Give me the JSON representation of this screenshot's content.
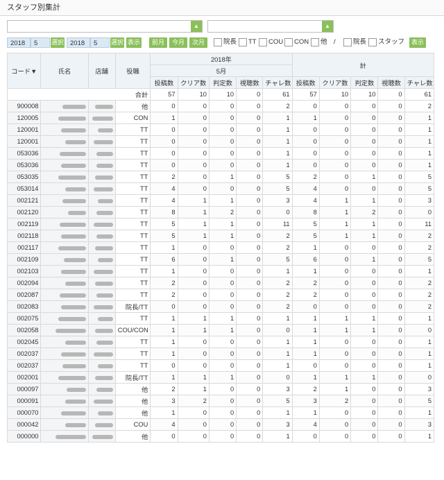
{
  "title": "スタッフ別集計",
  "controls": {
    "year1": "2018",
    "month1": "5",
    "select1": "選択",
    "year2": "2018",
    "month2": "5",
    "select2": "選択",
    "show": "表示",
    "prev": "前月",
    "current": "今月",
    "next": "次月",
    "filters": [
      "院長",
      "TT",
      "COU",
      "CON",
      "他"
    ],
    "separator": "/",
    "filters2": [
      "院長",
      "スタッフ"
    ],
    "show2": "表示"
  },
  "table": {
    "h_code": "コード▼",
    "h_name": "氏名",
    "h_store": "店舗",
    "h_role": "役職",
    "h_year": "2018年",
    "h_month": "5月",
    "h_total": "計",
    "cols": [
      "投稿数",
      "クリア数",
      "判定数",
      "視聴数",
      "チャレ数"
    ],
    "total_label": "合計",
    "total_values": [
      "57",
      "10",
      "10",
      "0",
      "61",
      "57",
      "10",
      "10",
      "0",
      "61"
    ],
    "rows": [
      {
        "code": "900008",
        "role": "他",
        "v": [
          "0",
          "0",
          "0",
          "0",
          "2",
          "0",
          "0",
          "0",
          "0",
          "2"
        ]
      },
      {
        "code": "120005",
        "role": "CON",
        "v": [
          "1",
          "0",
          "0",
          "0",
          "1",
          "1",
          "0",
          "0",
          "0",
          "1"
        ]
      },
      {
        "code": "120001",
        "role": "TT",
        "v": [
          "0",
          "0",
          "0",
          "0",
          "1",
          "0",
          "0",
          "0",
          "0",
          "1"
        ]
      },
      {
        "code": "120001",
        "role": "TT",
        "v": [
          "0",
          "0",
          "0",
          "0",
          "1",
          "0",
          "0",
          "0",
          "0",
          "1"
        ]
      },
      {
        "code": "053036",
        "role": "TT",
        "v": [
          "0",
          "0",
          "0",
          "0",
          "1",
          "0",
          "0",
          "0",
          "0",
          "1"
        ]
      },
      {
        "code": "053036",
        "role": "TT",
        "v": [
          "0",
          "0",
          "0",
          "0",
          "1",
          "0",
          "0",
          "0",
          "0",
          "1"
        ]
      },
      {
        "code": "053035",
        "role": "TT",
        "v": [
          "2",
          "0",
          "1",
          "0",
          "5",
          "2",
          "0",
          "1",
          "0",
          "5"
        ]
      },
      {
        "code": "053014",
        "role": "TT",
        "v": [
          "4",
          "0",
          "0",
          "0",
          "5",
          "4",
          "0",
          "0",
          "0",
          "5"
        ]
      },
      {
        "code": "002121",
        "role": "TT",
        "v": [
          "4",
          "1",
          "1",
          "0",
          "3",
          "4",
          "1",
          "1",
          "0",
          "3"
        ]
      },
      {
        "code": "002120",
        "role": "TT",
        "v": [
          "8",
          "1",
          "2",
          "0",
          "0",
          "8",
          "1",
          "2",
          "0",
          "0"
        ]
      },
      {
        "code": "002119",
        "role": "TT",
        "v": [
          "5",
          "1",
          "1",
          "0",
          "11",
          "5",
          "1",
          "1",
          "0",
          "11"
        ]
      },
      {
        "code": "002118",
        "role": "TT",
        "v": [
          "5",
          "1",
          "1",
          "0",
          "2",
          "5",
          "1",
          "1",
          "0",
          "2"
        ]
      },
      {
        "code": "002117",
        "role": "TT",
        "v": [
          "1",
          "0",
          "0",
          "0",
          "2",
          "1",
          "0",
          "0",
          "0",
          "2"
        ]
      },
      {
        "code": "002109",
        "role": "TT",
        "v": [
          "6",
          "0",
          "1",
          "0",
          "5",
          "6",
          "0",
          "1",
          "0",
          "5"
        ]
      },
      {
        "code": "002103",
        "role": "TT",
        "v": [
          "1",
          "0",
          "0",
          "0",
          "1",
          "1",
          "0",
          "0",
          "0",
          "1"
        ]
      },
      {
        "code": "002094",
        "role": "TT",
        "v": [
          "2",
          "0",
          "0",
          "0",
          "2",
          "2",
          "0",
          "0",
          "0",
          "2"
        ]
      },
      {
        "code": "002087",
        "role": "TT",
        "v": [
          "2",
          "0",
          "0",
          "0",
          "2",
          "2",
          "0",
          "0",
          "0",
          "2"
        ]
      },
      {
        "code": "002083",
        "role": "院長/TT",
        "v": [
          "0",
          "0",
          "0",
          "0",
          "2",
          "0",
          "0",
          "0",
          "0",
          "2"
        ]
      },
      {
        "code": "002075",
        "role": "TT",
        "v": [
          "1",
          "1",
          "1",
          "0",
          "1",
          "1",
          "1",
          "1",
          "0",
          "1"
        ]
      },
      {
        "code": "002058",
        "role": "COU/CON",
        "v": [
          "1",
          "1",
          "1",
          "0",
          "0",
          "1",
          "1",
          "1",
          "0",
          "0"
        ]
      },
      {
        "code": "002045",
        "role": "TT",
        "v": [
          "1",
          "0",
          "0",
          "0",
          "1",
          "1",
          "0",
          "0",
          "0",
          "1"
        ]
      },
      {
        "code": "002037",
        "role": "TT",
        "v": [
          "1",
          "0",
          "0",
          "0",
          "1",
          "1",
          "0",
          "0",
          "0",
          "1"
        ]
      },
      {
        "code": "002037",
        "role": "TT",
        "v": [
          "0",
          "0",
          "0",
          "0",
          "1",
          "0",
          "0",
          "0",
          "0",
          "1"
        ]
      },
      {
        "code": "002001",
        "role": "院長/TT",
        "v": [
          "1",
          "1",
          "1",
          "0",
          "0",
          "1",
          "1",
          "1",
          "0",
          "0"
        ]
      },
      {
        "code": "000097",
        "role": "他",
        "v": [
          "2",
          "1",
          "0",
          "0",
          "3",
          "2",
          "1",
          "0",
          "0",
          "3"
        ]
      },
      {
        "code": "000091",
        "role": "他",
        "v": [
          "3",
          "2",
          "0",
          "0",
          "5",
          "3",
          "2",
          "0",
          "0",
          "5"
        ]
      },
      {
        "code": "000070",
        "role": "他",
        "v": [
          "1",
          "0",
          "0",
          "0",
          "1",
          "1",
          "0",
          "0",
          "0",
          "1"
        ]
      },
      {
        "code": "000042",
        "role": "COU",
        "v": [
          "4",
          "0",
          "0",
          "0",
          "3",
          "4",
          "0",
          "0",
          "0",
          "3"
        ]
      },
      {
        "code": "000000",
        "role": "他",
        "v": [
          "0",
          "0",
          "0",
          "0",
          "1",
          "0",
          "0",
          "0",
          "0",
          "1"
        ]
      }
    ]
  }
}
